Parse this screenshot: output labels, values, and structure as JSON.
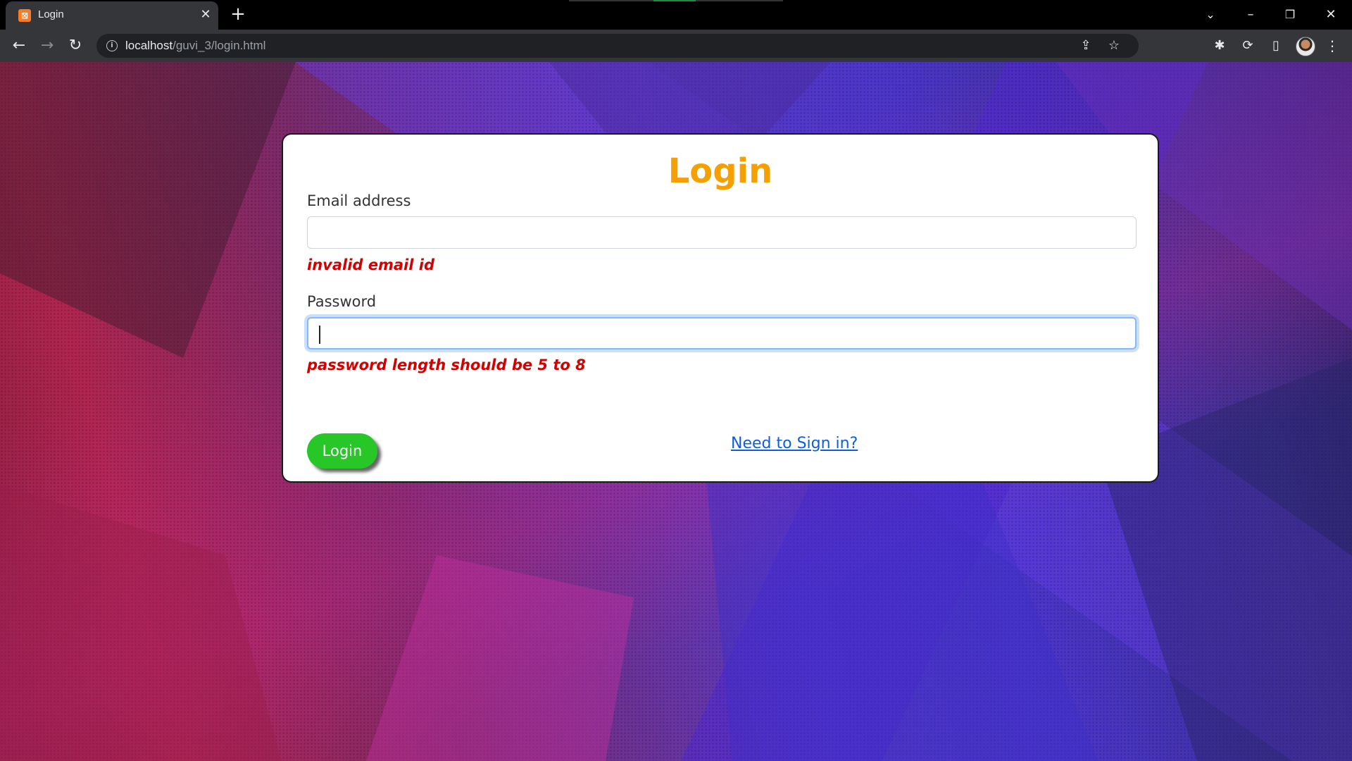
{
  "browser": {
    "tab_title": "Login",
    "url_host": "localhost",
    "url_path": "/guvi_3/login.html",
    "icons": {
      "favicon": "xampp-icon",
      "tab_close": "close-icon",
      "new_tab": "plus-icon",
      "back": "back-arrow-icon",
      "forward": "forward-arrow-icon",
      "reload": "reload-icon",
      "site_info": "info-icon",
      "share": "share-icon",
      "bookmark": "star-icon",
      "extensions": "puzzle-icon",
      "extension": "extension-icon",
      "side_panel": "side-panel-icon",
      "profile": "avatar",
      "menu": "kebab-menu-icon"
    }
  },
  "form": {
    "title": "Login",
    "email_label": "Email address",
    "email_value": "",
    "email_error": "invalid email id",
    "password_label": "Password",
    "password_value": "",
    "password_error": "password length should be 5 to 8",
    "login_button": "Login",
    "signin_link": "Need to Sign in?"
  },
  "colors": {
    "title": "#f5a000",
    "error": "#d40000",
    "button": "#28c728",
    "link": "#0d5edb",
    "focus_ring": "#86b7fe"
  }
}
